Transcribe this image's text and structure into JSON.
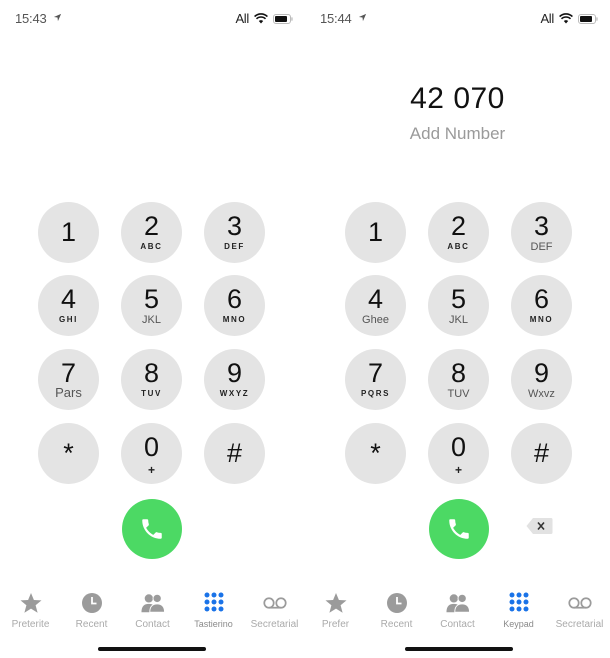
{
  "colors": {
    "key_background": "#e4e4e4",
    "call_green": "#4cd964",
    "active_tab_blue": "#1a73e8",
    "inactive_icon_gray": "#9b9b9b"
  },
  "screens": [
    {
      "status": {
        "time": "15:43",
        "carrier": "All",
        "location_icon": "location-arrow-icon",
        "wifi_icon": "wifi-icon",
        "battery_icon": "battery-icon"
      },
      "number_display": "",
      "add_number_label": "",
      "keys": [
        {
          "digit": "1",
          "letters": ""
        },
        {
          "digit": "2",
          "letters": "ABC"
        },
        {
          "digit": "3",
          "letters": "DEF"
        },
        {
          "digit": "4",
          "letters": "GHI"
        },
        {
          "digit": "5",
          "letters": "JKL"
        },
        {
          "digit": "6",
          "letters": "MNO"
        },
        {
          "digit": "7",
          "letters": "Pars"
        },
        {
          "digit": "8",
          "letters": "TUV"
        },
        {
          "digit": "9",
          "letters": "WXYZ"
        },
        {
          "digit": "*",
          "letters": ""
        },
        {
          "digit": "0",
          "letters": "+"
        },
        {
          "digit": "#",
          "letters": ""
        }
      ],
      "call_icon": "phone-icon",
      "show_delete": false,
      "tabs": [
        {
          "label": "Preterite",
          "icon": "star-icon"
        },
        {
          "label": "Recent",
          "icon": "clock-icon"
        },
        {
          "label": "Contact",
          "icon": "contacts-icon"
        },
        {
          "label": "Tastierino",
          "icon": "keypad-icon",
          "active": true
        },
        {
          "label": "Secretarial",
          "icon": "voicemail-icon"
        }
      ]
    },
    {
      "status": {
        "time": "15:44",
        "carrier": "All",
        "location_icon": "location-arrow-icon",
        "wifi_icon": "wifi-icon",
        "battery_icon": "battery-icon"
      },
      "number_display": "42 070",
      "add_number_label": "Add Number",
      "keys": [
        {
          "digit": "1",
          "letters": ""
        },
        {
          "digit": "2",
          "letters": "ABC"
        },
        {
          "digit": "3",
          "letters": "DEF"
        },
        {
          "digit": "4",
          "letters": "Ghee"
        },
        {
          "digit": "5",
          "letters": "JKL"
        },
        {
          "digit": "6",
          "letters": "MNO"
        },
        {
          "digit": "7",
          "letters": "PQRS"
        },
        {
          "digit": "8",
          "letters": "TUV"
        },
        {
          "digit": "9",
          "letters": "Wxvz"
        },
        {
          "digit": "*",
          "letters": ""
        },
        {
          "digit": "0",
          "letters": "+"
        },
        {
          "digit": "#",
          "letters": ""
        }
      ],
      "call_icon": "phone-icon",
      "show_delete": true,
      "delete_icon": "backspace-icon",
      "tabs": [
        {
          "label": "Prefer",
          "icon": "star-icon"
        },
        {
          "label": "Recent",
          "icon": "clock-icon"
        },
        {
          "label": "Contact",
          "icon": "contacts-icon"
        },
        {
          "label": "Keypad",
          "icon": "keypad-icon",
          "active": true
        },
        {
          "label": "Secretarial",
          "icon": "voicemail-icon"
        }
      ]
    }
  ]
}
